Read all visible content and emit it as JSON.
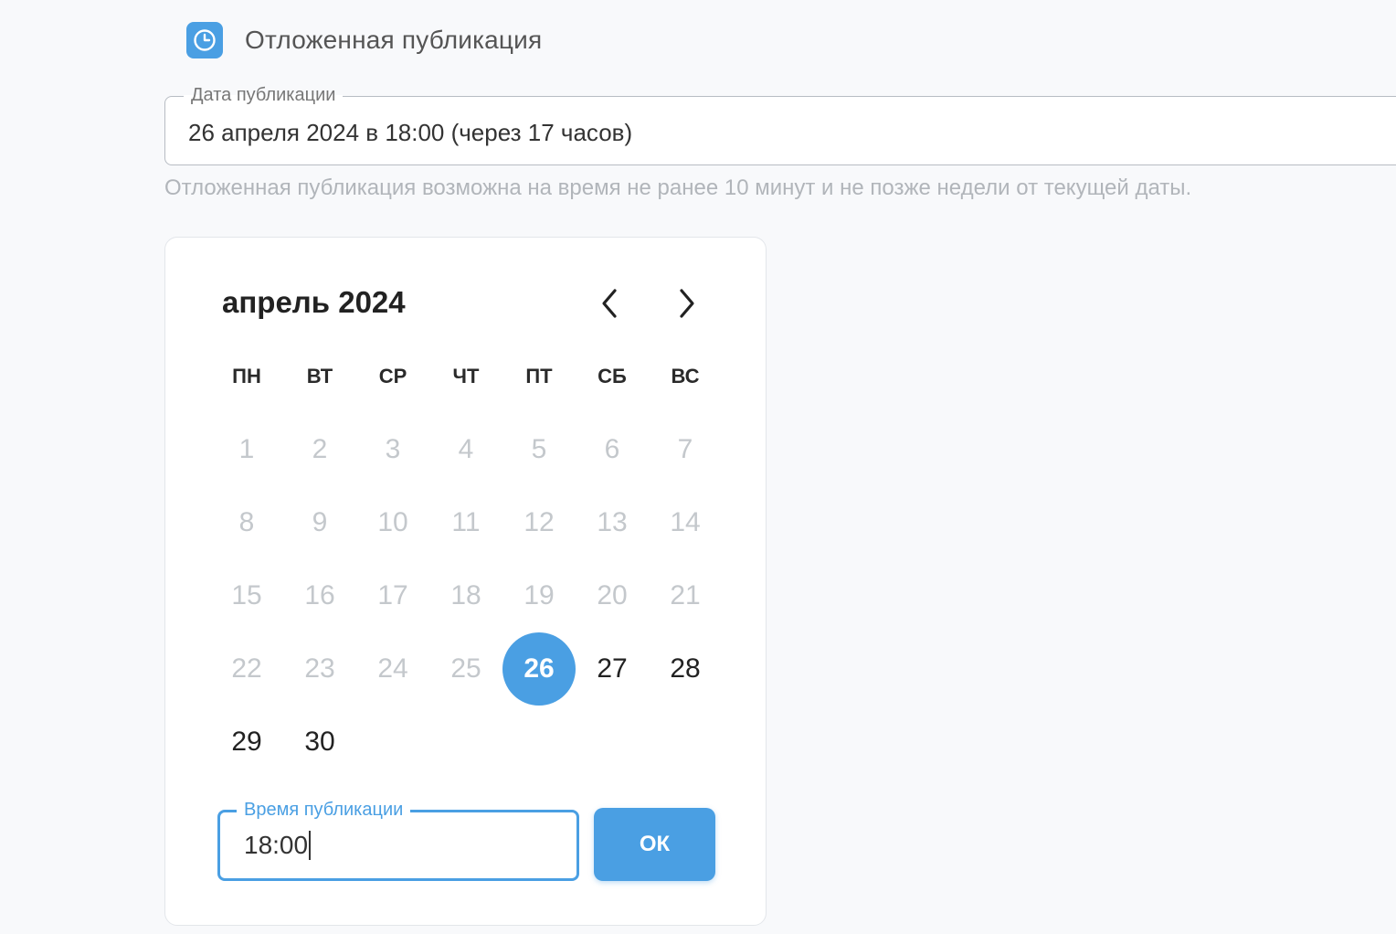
{
  "header": {
    "title": "Отложенная публикация",
    "icon": "clock-icon"
  },
  "date_field": {
    "label": "Дата публикации",
    "value": "26 апреля 2024 в 18:00 (через 17 часов)",
    "helper": "Отложенная публикация возможна на время не ранее 10 минут и не позже недели от текущей даты."
  },
  "calendar": {
    "month_label": "апрель 2024",
    "weekdays": [
      "ПН",
      "ВТ",
      "СР",
      "ЧТ",
      "ПТ",
      "СБ",
      "ВС"
    ],
    "days": [
      "1",
      "2",
      "3",
      "4",
      "5",
      "6",
      "7",
      "8",
      "9",
      "10",
      "11",
      "12",
      "13",
      "14",
      "15",
      "16",
      "17",
      "18",
      "19",
      "20",
      "21",
      "22",
      "23",
      "24",
      "25",
      "26",
      "27",
      "28",
      "29",
      "30"
    ],
    "selected_day": "26",
    "first_enabled_day": 26
  },
  "time_field": {
    "label": "Время публикации",
    "value": "18:00"
  },
  "ok_button": {
    "label": "ОК"
  },
  "colors": {
    "accent": "#4a9fe3",
    "disabled_text": "#c4c8cc",
    "helper_text": "#b1b5ba"
  }
}
